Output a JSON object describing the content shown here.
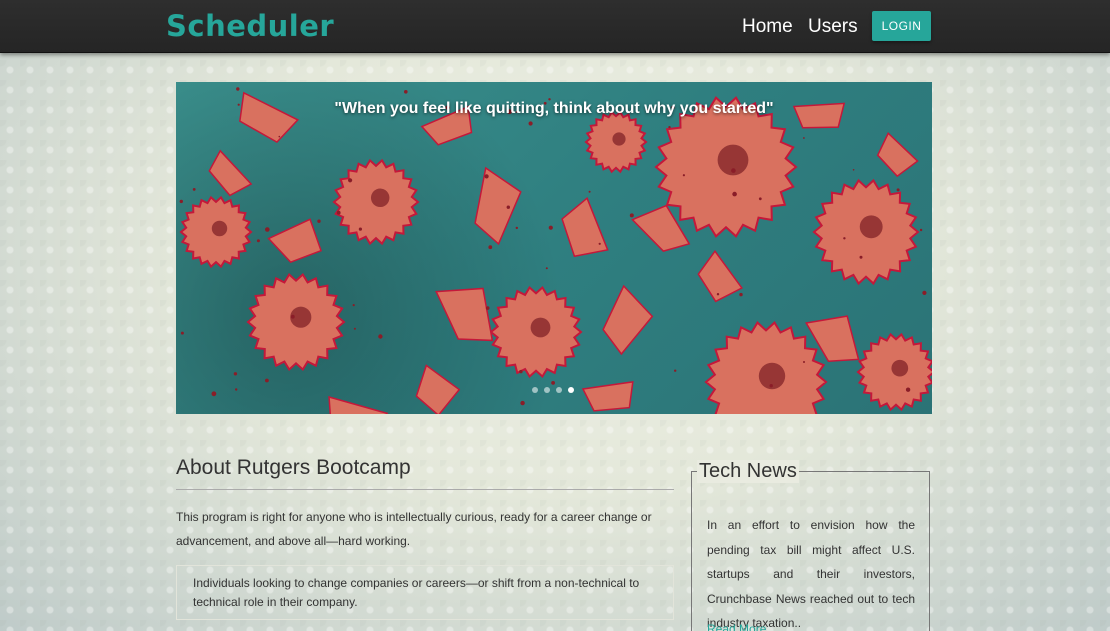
{
  "nav": {
    "brand": "Scheduler",
    "links": [
      "Home",
      "Users"
    ],
    "login_label": "LOGIN"
  },
  "carousel": {
    "caption": "\"When you feel like quitting, think about why you started\"",
    "slide_count": 4,
    "active_index": 3
  },
  "about": {
    "title": "About Rutgers Bootcamp",
    "paragraph": "This program is right for anyone who is intellectually curious, ready for a career change or advancement, and above all—hard working.",
    "quote": "Individuals looking to change companies or careers—or shift from a non-technical to technical role in their company."
  },
  "news": {
    "title": "Tech News",
    "body": "In an effort to envision how the pending tax bill might affect U.S. startups and their investors, Crunchbase News reached out to tech industry taxation..",
    "read_more": "Read More"
  },
  "colors": {
    "accent": "#26a69a",
    "navbar": "#2a2a2a",
    "shavings": "#d9715f",
    "shaving_edge": "#c4183a",
    "slide_background": "#347f82"
  }
}
